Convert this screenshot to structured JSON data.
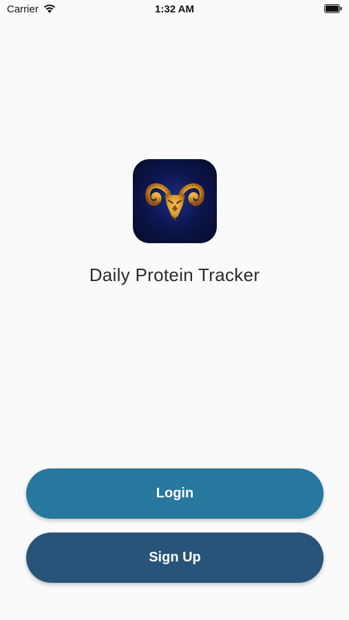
{
  "status_bar": {
    "carrier": "Carrier",
    "time": "1:32 AM",
    "wifi_icon": "wifi-icon",
    "battery_icon": "battery-icon"
  },
  "app": {
    "icon": "ram-head-logo-icon",
    "title": "Daily Protein Tracker"
  },
  "buttons": {
    "login_label": "Login",
    "signup_label": "Sign Up"
  },
  "colors": {
    "background": "#fafafa",
    "login_button": "#28779f",
    "signup_button": "#285479",
    "icon_background": "#0d1650",
    "logo_gold": "#d99a2b"
  }
}
